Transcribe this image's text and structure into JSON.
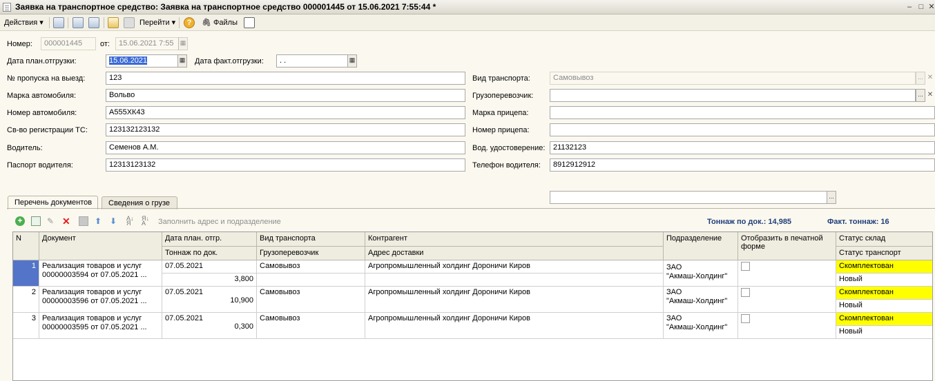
{
  "window": {
    "title": "Заявка на транспортное средство: Заявка на транспортное средство 000001445 от 15.06.2021 7:55:44 *"
  },
  "toolbar": {
    "actions_label": "Действия",
    "goto_label": "Перейти",
    "files_label": "Файлы"
  },
  "header": {
    "number_label": "Номер:",
    "number_value": "000001445",
    "from_label": "от:",
    "from_value": "15.06.2021  7:55",
    "plan_date_label": "Дата план.отгрузки:",
    "plan_date_value": "15.06.2021",
    "fact_date_label": "Дата факт.отгрузки:",
    "fact_date_value": " .  .",
    "pass_label": "№ пропуска на выезд:",
    "pass_value": "123",
    "car_brand_label": "Марка автомобиля:",
    "car_brand_value": "Вольво",
    "car_number_label": "Номер автомобиля:",
    "car_number_value": "А555ХК43",
    "reg_label": "Св-во регистрации ТС:",
    "reg_value": "123132123132",
    "driver_label": "Водитель:",
    "driver_value": "Семенов А.М.",
    "passport_label": "Паспорт водителя:",
    "passport_value": "12313123132",
    "transport_type_label": "Вид транспорта:",
    "transport_type_value": "Самовывоз",
    "carrier_label": "Грузоперевозчик:",
    "carrier_value": "",
    "trailer_brand_label": "Марка прицепа:",
    "trailer_brand_value": "",
    "trailer_number_label": "Номер прицепа:",
    "trailer_number_value": "",
    "license_label": "Вод. удостоверение:",
    "license_value": "21132123",
    "phone_label": "Телефон водителя:",
    "phone_value": "8912912912"
  },
  "tabs": [
    {
      "label": "Перечень документов"
    },
    {
      "label": "Сведения о грузе"
    }
  ],
  "table_toolbar": {
    "fill_label": "Заполнить адрес и подразделение",
    "tonnage_doc": "Тоннаж по док.: 14,985",
    "tonnage_fact": "Факт. тоннаж: 16"
  },
  "columns": {
    "n": "N",
    "document": "Документ",
    "plan_date": "Дата план. отгр.",
    "tonnage": "Тоннаж по док.",
    "transport": "Вид транспорта",
    "carrier": "Грузоперевозчик",
    "counterparty": "Контрагент",
    "address": "Адрес доставки",
    "division": "Подразделение",
    "print": "Отобразить в печатной форме",
    "warehouse_status": "Статус склад",
    "transport_status": "Статус транспорт"
  },
  "rows": [
    {
      "n": "1",
      "doc_line1": "Реализация товаров и услуг",
      "doc_line2": "00000003594 от 07.05.2021 ...",
      "plan_date": "07.05.2021",
      "tonnage": "3,800",
      "transport": "Самовывоз",
      "counterparty": "Агропромышленный холдинг Дороничи Киров",
      "division_line1": "ЗАО",
      "division_line2": "\"Акмаш-Холдинг\"",
      "warehouse_status": "Скомплектован",
      "transport_status": "Новый"
    },
    {
      "n": "2",
      "doc_line1": "Реализация товаров и услуг",
      "doc_line2": "00000003596 от 07.05.2021 ...",
      "plan_date": "07.05.2021",
      "tonnage": "10,900",
      "transport": "Самовывоз",
      "counterparty": "Агропромышленный холдинг Дороничи Киров",
      "division_line1": "ЗАО",
      "division_line2": "\"Акмаш-Холдинг\"",
      "warehouse_status": "Скомплектован",
      "transport_status": "Новый"
    },
    {
      "n": "3",
      "doc_line1": "Реализация товаров и услуг",
      "doc_line2": "00000003595 от 07.05.2021 ...",
      "plan_date": "07.05.2021",
      "tonnage": "0,300",
      "transport": "Самовывоз",
      "counterparty": "Агропромышленный холдинг Дороничи Киров",
      "division_line1": "ЗАО",
      "division_line2": "\"Акмаш-Холдинг\"",
      "warehouse_status": "Скомплектован",
      "transport_status": "Новый"
    }
  ]
}
